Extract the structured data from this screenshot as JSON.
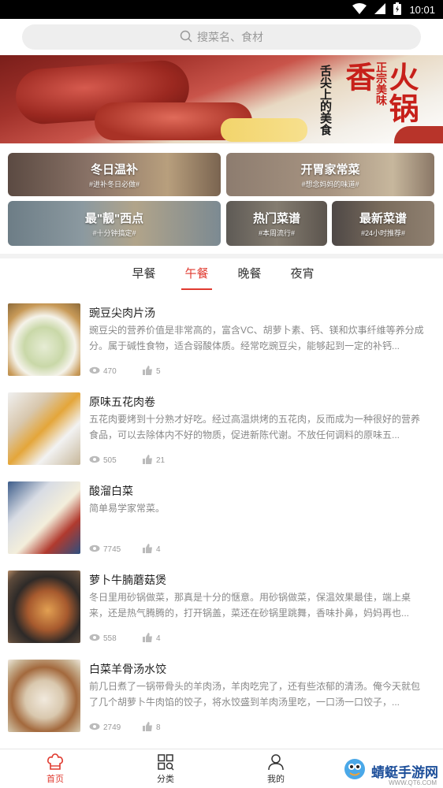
{
  "status_bar": {
    "time": "10:01"
  },
  "search": {
    "placeholder": "搜菜名、食材"
  },
  "banner": {
    "headline": "火锅香",
    "tagline_left": "舌尖上的美食",
    "tagline_right": "正宗美味"
  },
  "categories": [
    {
      "title": "冬日温补",
      "subtitle": "#进补冬日必做#"
    },
    {
      "title": "开胃家常菜",
      "subtitle": "#想念妈妈的味道#"
    },
    {
      "title": "最\"靓\"西点",
      "subtitle": "#十分钟搞定#"
    },
    {
      "title": "热门菜谱",
      "subtitle": "#本周流行#"
    },
    {
      "title": "最新菜谱",
      "subtitle": "#24小时推荐#"
    }
  ],
  "tabs": [
    {
      "label": "早餐"
    },
    {
      "label": "午餐"
    },
    {
      "label": "晚餐"
    },
    {
      "label": "夜宵"
    }
  ],
  "active_tab": "午餐",
  "accent_color": "#e03a2f",
  "recipes": [
    {
      "title": "豌豆尖肉片汤",
      "desc": "豌豆尖的营养价值是非常高的，富含VC、胡萝卜素、钙、镁和炊事纤维等养分成分。属于碱性食物，适合弱酸体质。经常吃豌豆尖，能够起到一定的补钙...",
      "views": "470",
      "likes": "5"
    },
    {
      "title": "原味五花肉卷",
      "desc": "五花肉要烤到十分熟才好吃。经过高温烘烤的五花肉，反而成为一种很好的营养食品，可以去除体内不好的物质，促进新陈代谢。不放任何调料的原味五...",
      "views": "505",
      "likes": "21"
    },
    {
      "title": "酸溜白菜",
      "desc": "简单易学家常菜。",
      "views": "7745",
      "likes": "4"
    },
    {
      "title": "萝卜牛腩蘑菇煲",
      "desc": "冬日里用砂锅做菜，那真是十分的惬意。用砂锅做菜，保温效果最佳，端上桌来，还是热气腾腾的，打开锅盖，菜还在砂锅里跳舞，香味扑鼻，妈妈再也...",
      "views": "558",
      "likes": "4"
    },
    {
      "title": "白菜羊骨汤水饺",
      "desc": "前几日煮了一锅带骨头的羊肉汤，羊肉吃完了，还有些浓郁的清汤。俺今天就包了几个胡萝卜牛肉馅的饺子，将水饺盛到羊肉汤里吃，一口汤一口饺子，...",
      "views": "2749",
      "likes": "8"
    }
  ],
  "bottom_nav": [
    {
      "label": "首页",
      "icon": "chef-hat-icon"
    },
    {
      "label": "分类",
      "icon": "grid-icon"
    },
    {
      "label": "我的",
      "icon": "user-icon"
    }
  ],
  "watermark": {
    "text": "蜻蜓手游网",
    "sub": "WWW.QT6.COM"
  }
}
